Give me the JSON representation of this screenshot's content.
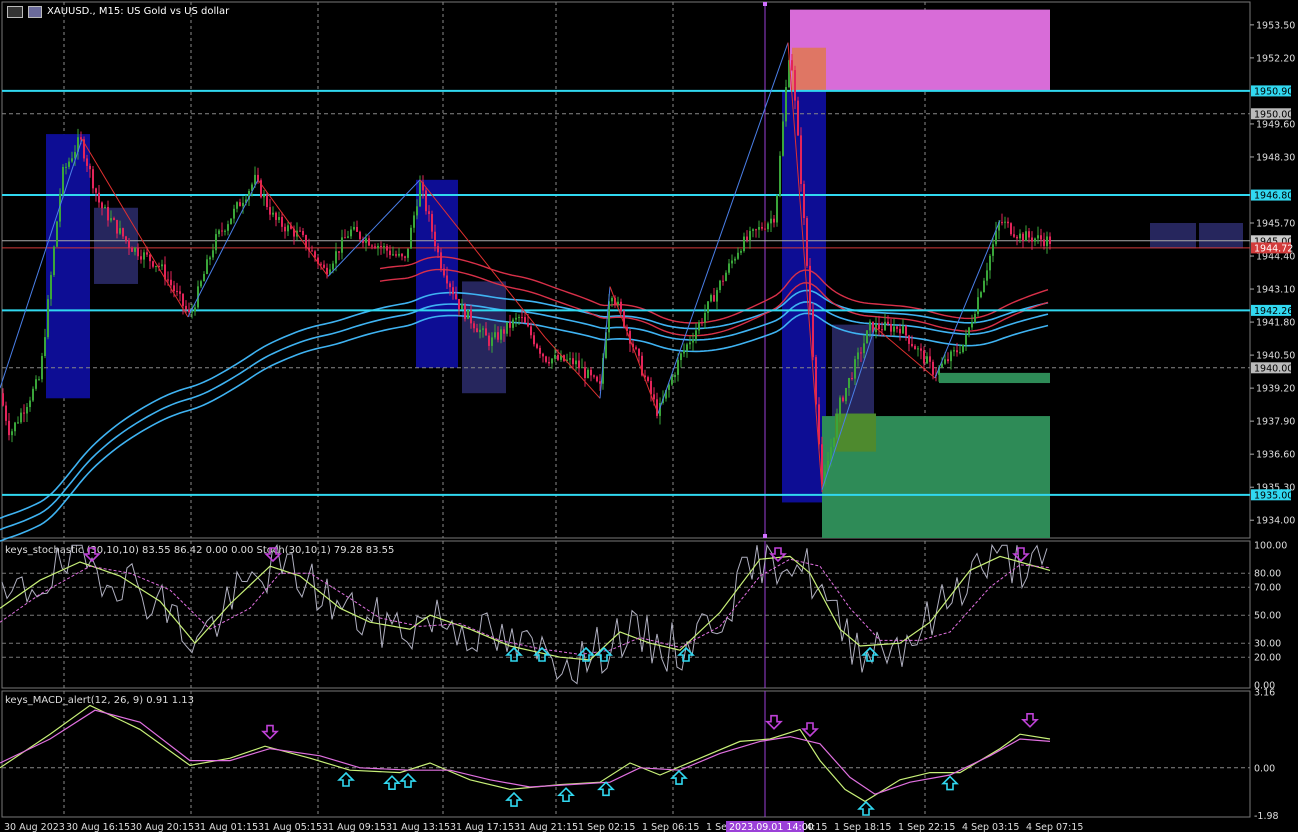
{
  "header": {
    "title": "XAUUSD., M15:  US Gold vs US dollar"
  },
  "stoch_label": "keys_stochastic (30,10,10) 83.55 86.42 0.00 0.00 Stoch(30,10,1) 79.28 83.55",
  "macd_label": "keys_MACD_alert(12, 26, 9) 0.91 1.13",
  "colors": {
    "bg": "#000000",
    "grid": "#8a8a8a",
    "bull": "#3aa63a",
    "bear": "#e3245a",
    "level": "#31d8f0",
    "ma_blue": "#3fb3f2",
    "ma_red": "#d83049",
    "zone_blue": "#0a0a8c",
    "zone_pink": "#e070e0",
    "zone_green": "#2e8b57",
    "marker_magenta": "#c042d8",
    "marker_cyan": "#31d8f0"
  },
  "chart_data": [
    {
      "type": "candlestick",
      "title": "XAUUSD., M15:  US Gold vs US dollar",
      "ylim": [
        1933.3,
        1954.4
      ],
      "y_ticks": [
        "1953.50",
        "1952.20",
        "1949.60",
        "1948.30",
        "1945.70",
        "1944.40",
        "1943.10",
        "1941.80",
        "1940.50",
        "1939.20",
        "1937.90",
        "1936.60",
        "1935.30",
        "1934.00"
      ],
      "x_tick_labels": [
        "30 Aug 2023",
        "30 Aug 16:15",
        "30 Aug 20:15",
        "31 Aug 01:15",
        "31 Aug 05:15",
        "31 Aug 09:15",
        "31 Aug 13:15",
        "31 Aug 17:15",
        "31 Aug 21:15",
        "1 Sep 02:15",
        "1 Sep 06:15",
        "1 Sep 10:15",
        "1 Sep 14:15",
        "1 Sep 18:15",
        "1 Sep 22:15",
        "4 Sep 03:15",
        "4 Sep 07:15"
      ],
      "crosshair_label": "2023.09.01 14:00",
      "price_path": [
        [
          0,
          1939.0
        ],
        [
          10,
          1937.4
        ],
        [
          40,
          1939.6
        ],
        [
          62,
          1947.6
        ],
        [
          80,
          1949.0
        ],
        [
          100,
          1946.4
        ],
        [
          130,
          1944.8
        ],
        [
          160,
          1944.0
        ],
        [
          190,
          1942.0
        ],
        [
          215,
          1945.0
        ],
        [
          255,
          1947.4
        ],
        [
          275,
          1945.8
        ],
        [
          300,
          1945.2
        ],
        [
          325,
          1943.8
        ],
        [
          350,
          1945.4
        ],
        [
          380,
          1944.8
        ],
        [
          405,
          1944.2
        ],
        [
          420,
          1947.2
        ],
        [
          440,
          1944.2
        ],
        [
          460,
          1942.4
        ],
        [
          490,
          1941.0
        ],
        [
          520,
          1942.0
        ],
        [
          545,
          1940.4
        ],
        [
          575,
          1940.2
        ],
        [
          600,
          1939.2
        ],
        [
          610,
          1943.2
        ],
        [
          630,
          1941.2
        ],
        [
          658,
          1938.2
        ],
        [
          680,
          1940.4
        ],
        [
          700,
          1941.8
        ],
        [
          740,
          1944.8
        ],
        [
          775,
          1946.0
        ],
        [
          790,
          1952.8
        ],
        [
          800,
          1948.0
        ],
        [
          812,
          1941.2
        ],
        [
          822,
          1935.2
        ],
        [
          840,
          1938.6
        ],
        [
          870,
          1941.6
        ],
        [
          900,
          1941.6
        ],
        [
          935,
          1939.8
        ],
        [
          965,
          1941.0
        ],
        [
          990,
          1944.4
        ],
        [
          1000,
          1945.8
        ],
        [
          1020,
          1945.2
        ],
        [
          1050,
          1945.0
        ]
      ],
      "horizontal_levels": [
        {
          "price": 1950.9,
          "label": "1950.90",
          "style": "solid"
        },
        {
          "price": 1946.8,
          "label": "1946.80",
          "style": "solid"
        },
        {
          "price": 1942.26,
          "label": "1942.26",
          "style": "solid"
        },
        {
          "price": 1935.0,
          "label": "1935.00",
          "style": "solid"
        },
        {
          "price": 1950.0,
          "label": "1950.00",
          "style": "dashed"
        },
        {
          "price": 1940.0,
          "label": "1940.00",
          "style": "dashed"
        },
        {
          "price": 1945.0,
          "label": "1945.00",
          "style": "current"
        },
        {
          "price": 1944.72,
          "label": "1944.72",
          "style": "current"
        }
      ],
      "zigzag": [
        [
          0,
          1939.2
        ],
        [
          82,
          1949.0
        ],
        [
          188,
          1942.0
        ],
        [
          258,
          1947.4
        ],
        [
          328,
          1943.6
        ],
        [
          420,
          1947.4
        ],
        [
          545,
          1941.2
        ],
        [
          600,
          1938.8
        ],
        [
          610,
          1943.2
        ],
        [
          658,
          1938.2
        ],
        [
          788,
          1952.8
        ],
        [
          822,
          1935.2
        ],
        [
          875,
          1941.6
        ],
        [
          935,
          1939.6
        ],
        [
          1000,
          1945.8
        ]
      ],
      "zones": [
        {
          "name": "blue",
          "x1": 46,
          "x2": 90,
          "p1": 1949.2,
          "p2": 1938.8
        },
        {
          "name": "blue-light",
          "x1": 94,
          "x2": 138,
          "p1": 1946.3,
          "p2": 1943.3
        },
        {
          "name": "blue",
          "x1": 416,
          "x2": 458,
          "p1": 1947.4,
          "p2": 1940.0
        },
        {
          "name": "blue-light",
          "x1": 462,
          "x2": 506,
          "p1": 1943.4,
          "p2": 1939.0
        },
        {
          "name": "blue",
          "x1": 782,
          "x2": 826,
          "p1": 1950.9,
          "p2": 1934.7
        },
        {
          "name": "blue-light",
          "x1": 832,
          "x2": 874,
          "p1": 1941.7,
          "p2": 1936.9
        },
        {
          "name": "pink",
          "x1": 790,
          "x2": 1050,
          "p1": 1954.1,
          "p2": 1950.9
        },
        {
          "name": "orange",
          "x1": 792,
          "x2": 826,
          "p1": 1952.6,
          "p2": 1950.9
        },
        {
          "name": "green",
          "x1": 822,
          "x2": 1050,
          "p1": 1938.1,
          "p2": 1933.3
        },
        {
          "name": "green",
          "x1": 939,
          "x2": 1050,
          "p1": 1939.8,
          "p2": 1939.4
        },
        {
          "name": "green-olive",
          "x1": 835,
          "x2": 876,
          "p1": 1938.2,
          "p2": 1936.7
        },
        {
          "name": "blue-light",
          "x1": 1150,
          "x2": 1196,
          "p1": 1945.7,
          "p2": 1944.7
        },
        {
          "name": "blue-light",
          "x1": 1199,
          "x2": 1243,
          "p1": 1945.7,
          "p2": 1944.7
        }
      ]
    },
    {
      "type": "line",
      "title": "keys_stochastic (30,10,10) 83.55 86.42 0.00 0.00 Stoch(30,10,1) 79.28 83.55",
      "ylim": [
        0,
        100
      ],
      "y_ticks": [
        "100.00",
        "80.00",
        "70.00",
        "50.00",
        "30.00",
        "20.00",
        "0.00"
      ],
      "series": [
        {
          "name": "main",
          "values": [
            [
              0,
              55
            ],
            [
              40,
              75
            ],
            [
              80,
              88
            ],
            [
              120,
              78
            ],
            [
              160,
              60
            ],
            [
              195,
              30
            ],
            [
              230,
              58
            ],
            [
              270,
              85
            ],
            [
              300,
              78
            ],
            [
              340,
              55
            ],
            [
              370,
              45
            ],
            [
              410,
              40
            ],
            [
              430,
              50
            ],
            [
              470,
              40
            ],
            [
              510,
              28
            ],
            [
              560,
              20
            ],
            [
              590,
              18
            ],
            [
              620,
              38
            ],
            [
              650,
              30
            ],
            [
              680,
              25
            ],
            [
              720,
              52
            ],
            [
              760,
              90
            ],
            [
              790,
              92
            ],
            [
              810,
              80
            ],
            [
              840,
              40
            ],
            [
              860,
              28
            ],
            [
              900,
              30
            ],
            [
              930,
              45
            ],
            [
              970,
              82
            ],
            [
              1000,
              92
            ],
            [
              1020,
              88
            ],
            [
              1050,
              82
            ]
          ]
        },
        {
          "name": "signal",
          "values": [
            [
              0,
              45
            ],
            [
              40,
              65
            ],
            [
              90,
              85
            ],
            [
              130,
              80
            ],
            [
              170,
              68
            ],
            [
              210,
              40
            ],
            [
              250,
              55
            ],
            [
              280,
              80
            ],
            [
              310,
              80
            ],
            [
              350,
              62
            ],
            [
              380,
              48
            ],
            [
              420,
              42
            ],
            [
              460,
              44
            ],
            [
              500,
              32
            ],
            [
              540,
              26
            ],
            [
              580,
              22
            ],
            [
              610,
              25
            ],
            [
              640,
              34
            ],
            [
              680,
              27
            ],
            [
              720,
              42
            ],
            [
              760,
              78
            ],
            [
              790,
              90
            ],
            [
              820,
              85
            ],
            [
              850,
              55
            ],
            [
              880,
              32
            ],
            [
              920,
              32
            ],
            [
              950,
              38
            ],
            [
              990,
              70
            ],
            [
              1020,
              86
            ],
            [
              1050,
              84
            ]
          ]
        }
      ],
      "markers": [
        {
          "x": 92,
          "kind": "down"
        },
        {
          "x": 273,
          "kind": "down"
        },
        {
          "x": 778,
          "kind": "down"
        },
        {
          "x": 1021,
          "kind": "down"
        },
        {
          "x": 514,
          "kind": "up"
        },
        {
          "x": 542,
          "kind": "up"
        },
        {
          "x": 586,
          "kind": "up"
        },
        {
          "x": 604,
          "kind": "up"
        },
        {
          "x": 686,
          "kind": "up"
        },
        {
          "x": 870,
          "kind": "up"
        }
      ]
    },
    {
      "type": "line",
      "title": "keys_MACD_alert(12, 26, 9) 0.91 1.13",
      "ylim": [
        -1.98,
        3.16
      ],
      "y_ticks": [
        "3.16",
        "0.00",
        "-1.98"
      ],
      "series": [
        {
          "name": "macd",
          "values": [
            [
              0,
              0.0
            ],
            [
              50,
              1.4
            ],
            [
              90,
              2.6
            ],
            [
              140,
              1.6
            ],
            [
              190,
              0.1
            ],
            [
              230,
              0.4
            ],
            [
              265,
              0.9
            ],
            [
              310,
              0.4
            ],
            [
              350,
              -0.1
            ],
            [
              400,
              -0.2
            ],
            [
              430,
              0.2
            ],
            [
              470,
              -0.5
            ],
            [
              510,
              -0.9
            ],
            [
              560,
              -0.7
            ],
            [
              600,
              -0.6
            ],
            [
              630,
              0.2
            ],
            [
              660,
              -0.3
            ],
            [
              700,
              0.4
            ],
            [
              740,
              1.1
            ],
            [
              770,
              1.2
            ],
            [
              800,
              1.6
            ],
            [
              820,
              0.3
            ],
            [
              845,
              -0.9
            ],
            [
              865,
              -1.4
            ],
            [
              900,
              -0.5
            ],
            [
              930,
              -0.2
            ],
            [
              960,
              -0.2
            ],
            [
              1000,
              0.8
            ],
            [
              1020,
              1.4
            ],
            [
              1050,
              1.2
            ]
          ]
        },
        {
          "name": "signal",
          "values": [
            [
              0,
              0.2
            ],
            [
              50,
              1.2
            ],
            [
              95,
              2.4
            ],
            [
              140,
              1.9
            ],
            [
              190,
              0.3
            ],
            [
              230,
              0.3
            ],
            [
              270,
              0.8
            ],
            [
              320,
              0.5
            ],
            [
              360,
              0.0
            ],
            [
              410,
              -0.1
            ],
            [
              450,
              -0.1
            ],
            [
              490,
              -0.5
            ],
            [
              530,
              -0.8
            ],
            [
              570,
              -0.7
            ],
            [
              610,
              -0.6
            ],
            [
              640,
              0.0
            ],
            [
              680,
              -0.1
            ],
            [
              720,
              0.6
            ],
            [
              760,
              1.1
            ],
            [
              790,
              1.3
            ],
            [
              820,
              1.0
            ],
            [
              850,
              -0.4
            ],
            [
              875,
              -1.1
            ],
            [
              910,
              -0.6
            ],
            [
              950,
              -0.3
            ],
            [
              990,
              0.5
            ],
            [
              1020,
              1.2
            ],
            [
              1050,
              1.1
            ]
          ]
        }
      ],
      "markers": [
        {
          "x": 270,
          "kind": "down"
        },
        {
          "x": 774,
          "kind": "down"
        },
        {
          "x": 810,
          "kind": "down"
        },
        {
          "x": 1030,
          "kind": "down"
        },
        {
          "x": 346,
          "kind": "up"
        },
        {
          "x": 392,
          "kind": "up"
        },
        {
          "x": 408,
          "kind": "up"
        },
        {
          "x": 514,
          "kind": "up"
        },
        {
          "x": 566,
          "kind": "up"
        },
        {
          "x": 606,
          "kind": "up"
        },
        {
          "x": 679,
          "kind": "up"
        },
        {
          "x": 866,
          "kind": "up"
        },
        {
          "x": 950,
          "kind": "up"
        }
      ]
    }
  ]
}
